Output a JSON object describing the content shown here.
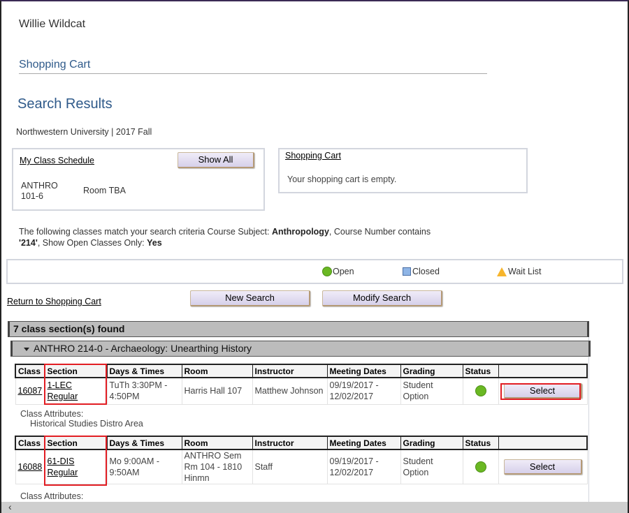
{
  "header": {
    "user_name": "Willie Wildcat",
    "cart_title": "Shopping Cart",
    "search_title": "Search Results",
    "institution_term": "Northwestern University | 2017 Fall"
  },
  "schedule_box": {
    "link": "My Class Schedule",
    "show_all_label": "Show All",
    "course": "ANTHRO 101-6",
    "room": "Room  TBA"
  },
  "cart_box": {
    "link": "Shopping Cart",
    "empty_message": "Your shopping cart is empty."
  },
  "criteria": {
    "prefix": "The following classes match your search criteria Course Subject: ",
    "subject": "Anthropology",
    "middle": ",  Course Number contains ",
    "number": "'214'",
    "open_label": ",  Show Open Classes Only: ",
    "open_value": "Yes"
  },
  "legend": {
    "open": "Open",
    "closed": "Closed",
    "wait_list": "Wait List",
    "colors": {
      "open": "#6ab823",
      "closed": "#8fb5e6",
      "wait_list": "#f7b52c"
    }
  },
  "actions": {
    "return_link": "Return to Shopping Cart",
    "new_search": "New Search",
    "modify_search": "Modify Search"
  },
  "results": {
    "count_label": "7 class section(s) found",
    "course_title": "ANTHRO 214-0 - Archaeology: Unearthing History",
    "columns": [
      "Class",
      "Section",
      "Days & Times",
      "Room",
      "Instructor",
      "Meeting Dates",
      "Grading",
      "Status",
      ""
    ],
    "sections": [
      {
        "class_nbr": "16087",
        "section_line1": "1-LEC",
        "section_line2": "Regular",
        "days_times": "TuTh 3:30PM - 4:50PM",
        "room": "Harris Hall 107",
        "instructor": "Matthew Johnson",
        "meeting_dates": "09/19/2017 - 12/02/2017",
        "grading": "Student Option",
        "status": "Open",
        "select_label": "Select",
        "attributes_label": "Class Attributes:",
        "attributes_value": "Historical Studies Distro Area"
      },
      {
        "class_nbr": "16088",
        "section_line1": "61-DIS",
        "section_line2": "Regular",
        "days_times": "Mo 9:00AM - 9:50AM",
        "room": "ANTHRO Sem Rm 104 - 1810 Hinmn",
        "instructor": "Staff",
        "meeting_dates": "09/19/2017 - 12/02/2017",
        "grading": "Student Option",
        "status": "Open",
        "select_label": "Select",
        "attributes_label": "Class Attributes:"
      }
    ]
  },
  "scrollbar": {
    "left_arrow": "‹"
  }
}
